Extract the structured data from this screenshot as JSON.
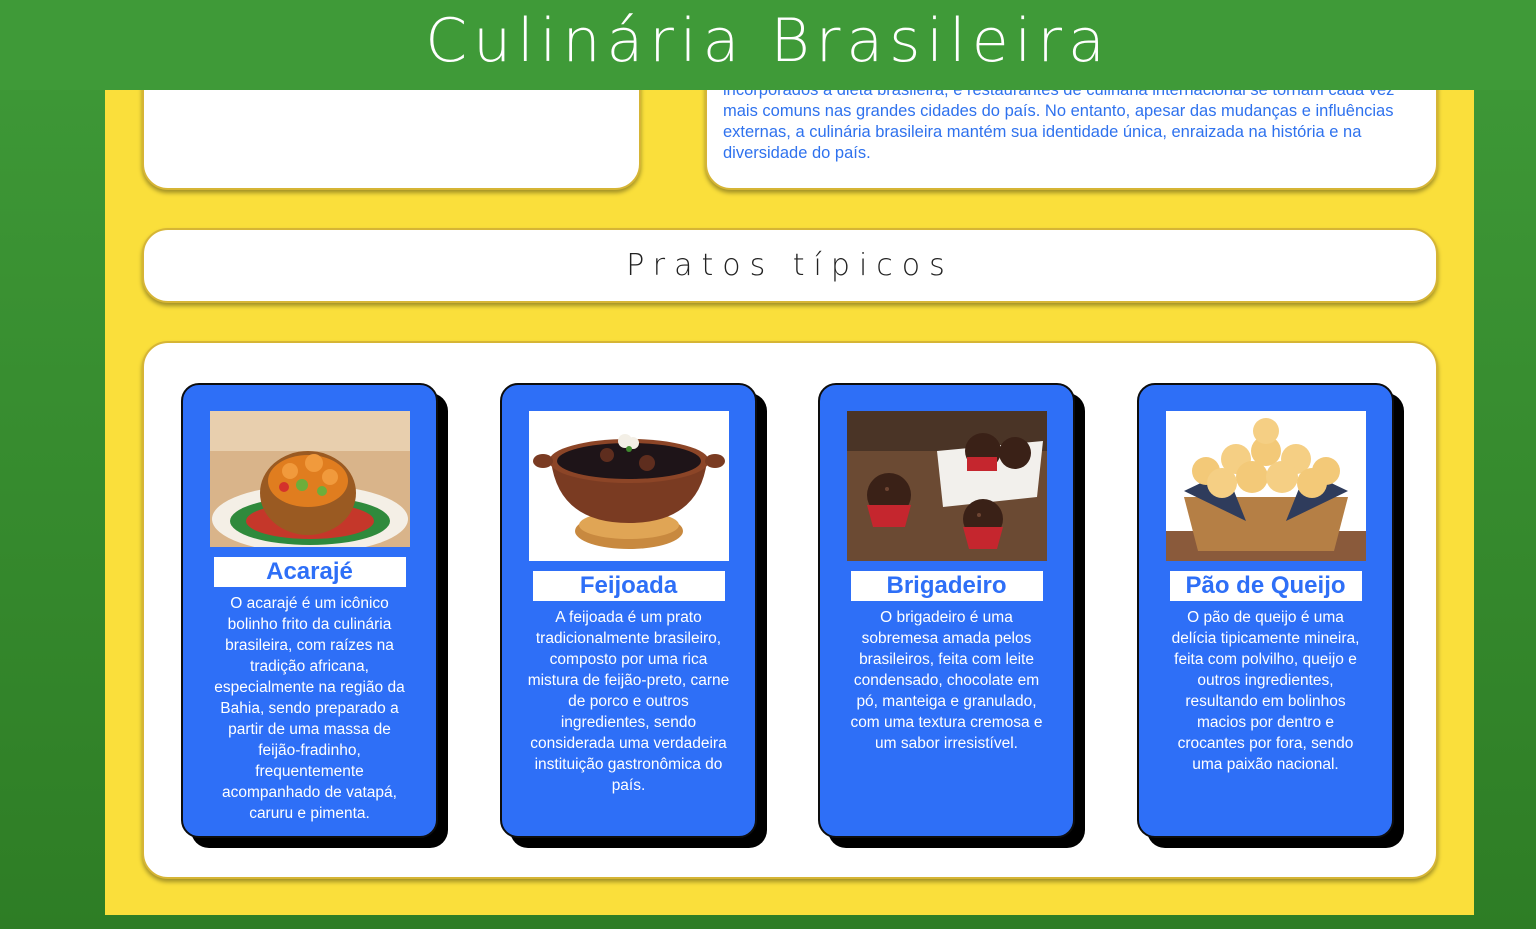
{
  "header": {
    "title": "Culinária Brasileira"
  },
  "intro": {
    "text": "incorporados à dieta brasileira, e restaurantes de culinária internacional se tornam cada vez mais comuns nas grandes cidades do país. No entanto, apesar das mudanças e influências externas, a culinária brasileira mantém sua identidade única, enraizada na história e na diversidade do país."
  },
  "section": {
    "title": "Pratos típicos"
  },
  "dishes": [
    {
      "name": "Acarajé",
      "image_icon": "acaraje-photo",
      "description": "O acarajé é um icônico bolinho frito da culinária brasileira, com raízes na tradição africana, especialmente na região da Bahia, sendo preparado a partir de uma massa de feijão-fradinho, frequentemente acompanhado de vatapá, caruru e pimenta."
    },
    {
      "name": "Feijoada",
      "image_icon": "feijoada-photo",
      "description": "A feijoada é um prato tradicionalmente brasileiro, composto por uma rica mistura de feijão-preto, carne de porco e outros ingredientes, sendo considerada uma verdadeira instituição gastronômica do país."
    },
    {
      "name": "Brigadeiro",
      "image_icon": "brigadeiro-photo",
      "description": "O brigadeiro é uma sobremesa amada pelos brasileiros, feita com leite condensado, chocolate em pó, manteiga e granulado, com uma textura cremosa e um sabor irresistível."
    },
    {
      "name": "Pão de Queijo",
      "image_icon": "pao-de-queijo-photo",
      "description": "O pão de queijo é uma delícia tipicamente mineira, feita com polvilho, queijo e outros ingredientes, resultando em bolinhos macios por dentro e crocantes por fora, sendo uma paixão nacional."
    }
  ],
  "colors": {
    "brand_green": "#3f9a38",
    "panel_yellow": "#fadf3b",
    "card_blue": "#2e6ff7",
    "intro_text_blue": "#2f72ee"
  }
}
